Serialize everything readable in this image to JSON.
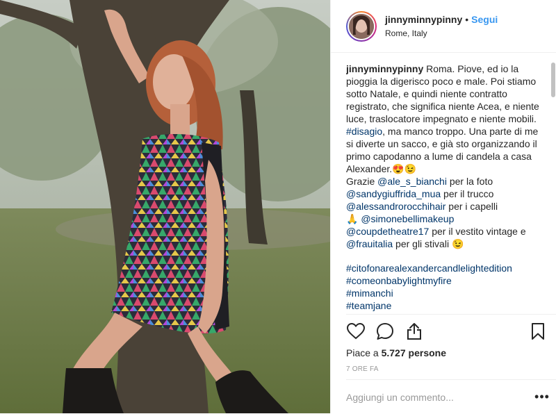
{
  "header": {
    "username": "jinnyminnypinny",
    "separator": "•",
    "follow_label": "Segui",
    "location": "Rome, Italy"
  },
  "caption": {
    "username": "jinnyminnypinny",
    "text_1": "Roma. Piove, ed io la pioggia la digerisco poco e male. Poi stiamo sotto Natale, e quindi niente contratto registrato, che significa niente Acea, e niente luce, traslocatore impegnato e niente mobili.",
    "hashtag_disagio": "#disagio",
    "text_2": ", ma manco troppo. Una parte di me si diverte un sacco, e già sto organizzando il primo capodanno a lume di candela a casa Alexander.",
    "emoji_1": "😍😉",
    "credit_1_prefix": "Grazie",
    "credit_1_user": "@ale_s_bianchi",
    "credit_1_text": "per la foto",
    "credit_2_user": "@sandygiuffrida_mua",
    "credit_2_text": "per il trucco",
    "credit_3_user": "@alessandrorocchihair",
    "credit_3_text": "per i capelli",
    "credit_4_emoji": "🙏",
    "credit_4_user": "@simonebellimakeup",
    "credit_5_user": "@coupdetheatre17",
    "credit_5_text": "per il vestito vintage e",
    "credit_6_user": "@frauitalia",
    "credit_6_text": "per gli stivali",
    "credit_6_emoji": "😉",
    "hashtags": [
      "#citofonarealexandercandlelightedition",
      "#comeonbabylightmyfire",
      "#mimanchi",
      "#teamjane",
      "#"
    ]
  },
  "actions": {
    "like_icon": "heart-icon",
    "comment_icon": "comment-icon",
    "share_icon": "share-icon",
    "save_icon": "bookmark-icon"
  },
  "likes": {
    "prefix": "Piace a",
    "count": "5.727",
    "suffix": "persone"
  },
  "timestamp": "7 ORE FA",
  "comment_box": {
    "placeholder": "Aggiungi un commento...",
    "more_label": "•••"
  }
}
